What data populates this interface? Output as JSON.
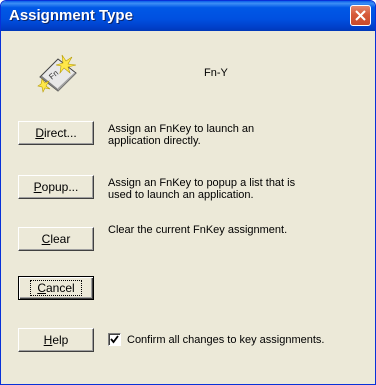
{
  "window": {
    "title": "Assignment Type",
    "key_label": "Fn-Y"
  },
  "buttons": {
    "direct": {
      "acc": "D",
      "rest": "irect..."
    },
    "popup": {
      "acc": "P",
      "rest": "opup..."
    },
    "clear": {
      "acc": "C",
      "rest": "lear"
    },
    "cancel": {
      "acc": "C",
      "rest": "ancel"
    },
    "help": {
      "acc": "H",
      "rest": "elp"
    }
  },
  "descriptions": {
    "direct_line1": "Assign an FnKey to launch an",
    "direct_line2": "application directly.",
    "popup_line1": "Assign an FnKey to popup a list that is",
    "popup_line2": "used to launch an application.",
    "clear": "Clear the current FnKey assignment."
  },
  "confirm": {
    "label": "Confirm all changes to key assignments.",
    "checked": true
  },
  "icons": {
    "close": "close-icon",
    "app": "fn-key-icon",
    "check": "checkmark-icon"
  },
  "colors": {
    "titlebar": "#0058e6",
    "close": "#d65a3a",
    "face": "#ece9d8"
  }
}
